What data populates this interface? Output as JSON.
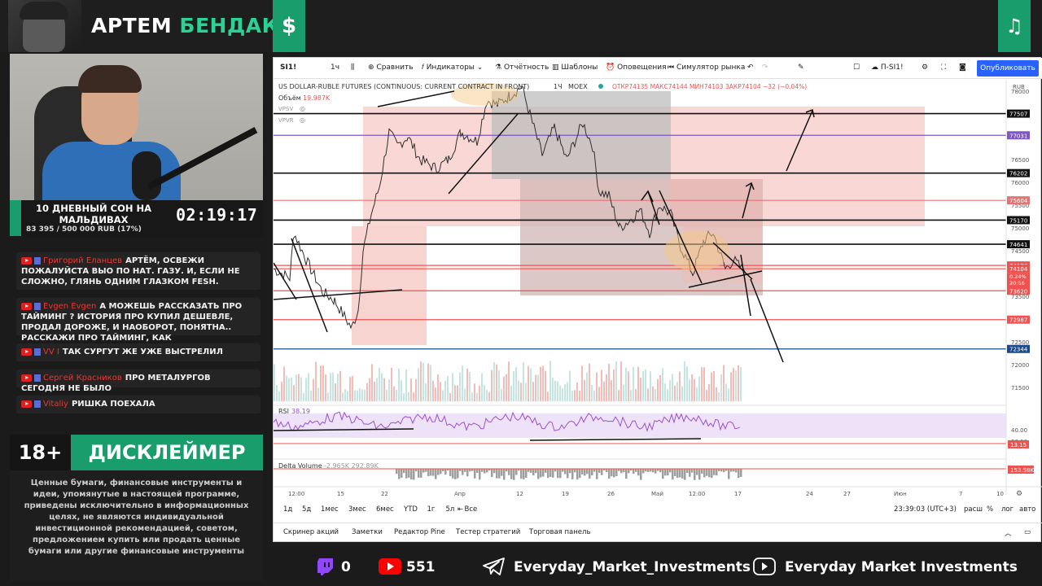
{
  "header": {
    "brand_first": "АРТЕМ",
    "brand_second": "БЕНДАК",
    "dollar_icon": "$",
    "music_icon": "♫"
  },
  "goal": {
    "title": "10 ДНЕВНЫЙ СОН НА МАЛЬДИВАХ",
    "progress_text": "83 395 / 500 000 RUB (17%)",
    "progress_pct": 17,
    "timer": "02:19:17"
  },
  "chat": [
    {
      "name": "Григорий Еланцев",
      "text": "АРТЁМ, ОСВЕЖИ ПОЖАЛУЙСТА ВЫО ПО НАТ. ГАЗУ. И, ЕСЛИ НЕ СЛОЖНО, ГЛЯНЬ ОДНИМ ГЛАЗКОМ FESH."
    },
    {
      "name": "Evgen Evgen",
      "text": "А МОЖЕШЬ РАССКАЗАТЬ ПРО ТАЙМИНГ ? ИСТОРИЯ ПРО КУПИЛ ДЕШЕВЛЕ, ПРОДАЛ ДОРОЖЕ, И НАОБОРОТ, ПОНЯТНА.. РАССКАЖИ ПРО ТАЙМИНГ, КАК АНАЛИЗИРУЕШЬ?"
    },
    {
      "name": "VV I",
      "text": "ТАК СУРГУТ ЖЕ УЖЕ ВЫСТРЕЛИЛ"
    },
    {
      "name": "Сергей Красников",
      "text": "ПРО МЕТАЛУРГОВ СЕГОДНЯ НЕ БЫЛО"
    },
    {
      "name": "Vitaliy",
      "text": "РИШКА ПОЕХАЛА"
    }
  ],
  "disclaimer": {
    "age": "18+",
    "title": "ДИСКЛЕЙМЕР",
    "text": "Ценные бумаги, финансовые инструменты и идеи, упомянутые в настоящей программе, приведены исключительно в информационных целях, не являются индивидуальной инвестиционной рекомендацией, советом, предложением купить или продать ценные бумаги или другие финансовые инструменты"
  },
  "tv": {
    "toolbar": {
      "symbol": "SI1!",
      "interval": "1ч",
      "compare": "Сравнить",
      "indicators": "Индикаторы",
      "financials": "Отчётность",
      "templates": "Шаблоны",
      "alerts": "Оповещения",
      "replay": "Симулятор рынка",
      "layout": "П-SI1!",
      "publish": "Опубликовать"
    },
    "legend": {
      "title": "US DOLLAR-RUBLE FUTURES (CONTINUOUS: CURRENT CONTRACT IN FRONT)",
      "interval": "1Ч",
      "exchange": "MOEX",
      "ohlc": "ОТКР74135 МАКС74144 МИН74103 ЗАКР74104 −32 (−0.04%)",
      "volume_label": "Объём",
      "volume_value": "19.987K",
      "vpsv": "VPSV",
      "vpvr": "VPVR",
      "rsi_label": "RSI",
      "rsi_value": "38.19",
      "delta_label": "Delta Volume",
      "delta_value": "-2.965K 292.89K",
      "currency": "RUB"
    },
    "price_scale": [
      "78000",
      "77500",
      "77000",
      "76500",
      "76000",
      "75500",
      "75000",
      "74500",
      "74000",
      "73500",
      "73000",
      "72500",
      "72000",
      "71500"
    ],
    "level_labels": [
      {
        "text": "77507",
        "color": "#111111"
      },
      {
        "text": "77031",
        "color": "#7e57c2"
      },
      {
        "text": "76202",
        "color": "#111111"
      },
      {
        "text": "75604",
        "color": "#e57373"
      },
      {
        "text": "75170",
        "color": "#111111"
      },
      {
        "text": "74641",
        "color": "#111111"
      },
      {
        "text": "74176",
        "color": "#ef5350"
      },
      {
        "text": "74104",
        "color": "#ef5350"
      },
      {
        "text": "73620",
        "color": "#ef5350"
      },
      {
        "text": "72987",
        "color": "#ef5350"
      },
      {
        "text": "72344",
        "color": "#1a4a8a"
      }
    ],
    "last_price": {
      "price": "74104",
      "pct": "0.24%",
      "time": "20:56"
    },
    "rsi_scale": [
      "40.00",
      "20.00"
    ],
    "rsi_marker": "13.15",
    "delta_marker": "153.58K",
    "time_axis": [
      "12:00",
      "15",
      "22",
      "Апр",
      "12",
      "19",
      "26",
      "Май",
      "12:00",
      "17",
      "24",
      "27",
      "Июн",
      "7",
      "10"
    ],
    "timeframes": [
      "1д",
      "5д",
      "1мес",
      "3мес",
      "6мес",
      "YTD",
      "1г",
      "5л",
      "Все"
    ],
    "clock": "23:39:03 (UTC+3)",
    "scale_opts": [
      "расш",
      "%",
      "лог",
      "авто"
    ],
    "tabs": [
      "Скринер акций",
      "Заметки",
      "Редактор Pine",
      "Тестер стратегий",
      "Торговая панель"
    ]
  },
  "footer": {
    "twitch_count": "0",
    "youtube_count": "551",
    "telegram": "Everyday_Market_Investments",
    "youtube_channel": "Everyday Market Investments"
  },
  "colors": {
    "brand_green": "#1a9d6c",
    "tv_blue": "#2962ff",
    "zone_red": "#f4b7b2",
    "zone_gray": "#c9c9c9"
  }
}
